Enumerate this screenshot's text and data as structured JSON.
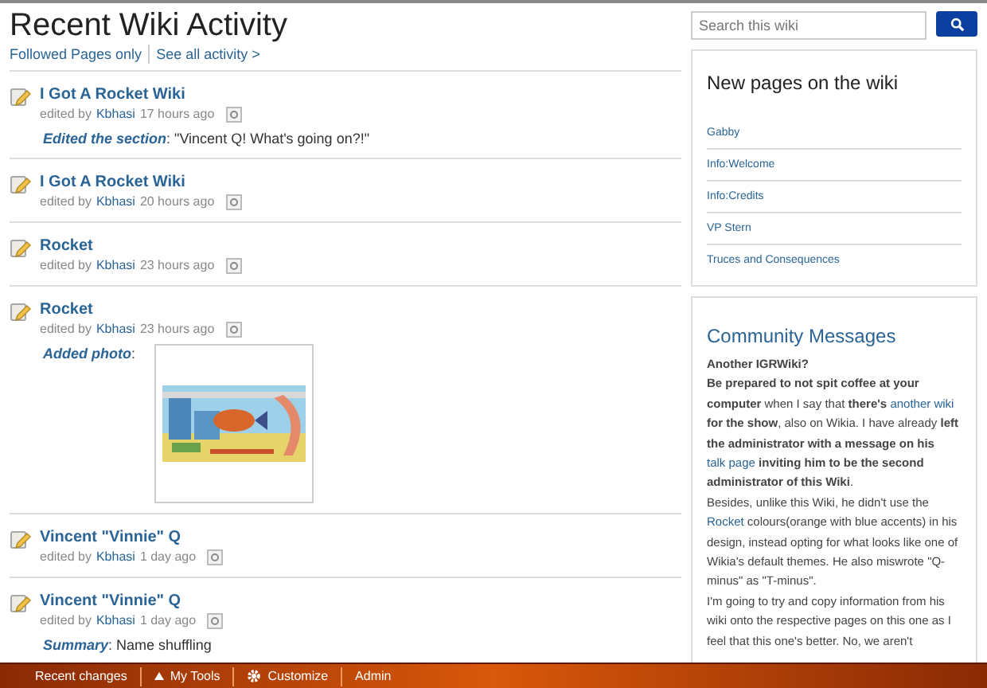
{
  "header": {
    "title": "Recent Wiki Activity",
    "links": [
      {
        "label": "Followed Pages only"
      },
      {
        "label": "See all activity >"
      }
    ]
  },
  "activity": [
    {
      "title": "I Got A Rocket Wiki",
      "prefix": "edited by",
      "user": "Kbhasi",
      "time": "17 hours ago",
      "detail": {
        "kind": "text",
        "label": "Edited the section",
        "value": ": \"Vincent Q! What's going on?!\""
      }
    },
    {
      "title": "I Got A Rocket Wiki",
      "prefix": "edited by",
      "user": "Kbhasi",
      "time": "20 hours ago"
    },
    {
      "title": "Rocket",
      "prefix": "edited by",
      "user": "Kbhasi",
      "time": "23 hours ago"
    },
    {
      "title": "Rocket",
      "prefix": "edited by",
      "user": "Kbhasi",
      "time": "23 hours ago",
      "detail": {
        "label": "Added photo",
        "value": ":"
      }
    },
    {
      "title": "Vincent \"Vinnie\" Q",
      "prefix": "edited by",
      "user": "Kbhasi",
      "time": "1 day ago"
    },
    {
      "title": "Vincent \"Vinnie\" Q",
      "prefix": "edited by",
      "user": "Kbhasi",
      "time": "1 day ago",
      "detail": {
        "kind": "text",
        "label": "Summary",
        "value": ": Name shuffling"
      }
    }
  ],
  "search": {
    "placeholder": "Search this wiki"
  },
  "new_pages": {
    "title": "New pages on the wiki",
    "items": [
      "Gabby",
      "Info:Welcome",
      "Info:Credits",
      "VP Stern",
      "Truces and Consequences"
    ]
  },
  "community": {
    "title": "Community Messages",
    "paragraphs": [
      [
        {
          "kind": "text",
          "text": "**Another IGRWiki?**"
        }
      ],
      [
        {
          "kind": "text",
          "text": "**Be prepared to not spit coffee at your computer** when I say that **there's** "
        },
        {
          "kind": "link",
          "text": "another wiki"
        },
        {
          "kind": "text",
          "text": " **for the show**, also on Wikia. I have already **left the administrator with a message on his** "
        },
        {
          "kind": "link",
          "text": "talk page"
        },
        {
          "kind": "text",
          "text": " **inviting him to be the second administrator of this Wiki**."
        }
      ],
      [
        {
          "kind": "text",
          "text": "Besides, unlike this Wiki, he didn't use the "
        },
        {
          "kind": "link",
          "text": "Rocket"
        },
        {
          "kind": "text",
          "text": " colours(orange with blue accents) in his design, instead opting for what looks like one of Wikia's default themes. He also miswrote \"Q-minus\" as \"T-minus\"."
        }
      ],
      [
        {
          "kind": "text",
          "text": "I'm going to try and copy information from his wiki onto the respective pages on this one as I feel that this one's better. No, we aren't"
        }
      ]
    ]
  },
  "toolbar": [
    {
      "kind": "text",
      "label": "Recent changes"
    },
    {
      "kind": "menu",
      "label": "My Tools"
    },
    {
      "kind": "gear",
      "label": "Customize"
    },
    {
      "kind": "text",
      "label": "Admin"
    }
  ]
}
